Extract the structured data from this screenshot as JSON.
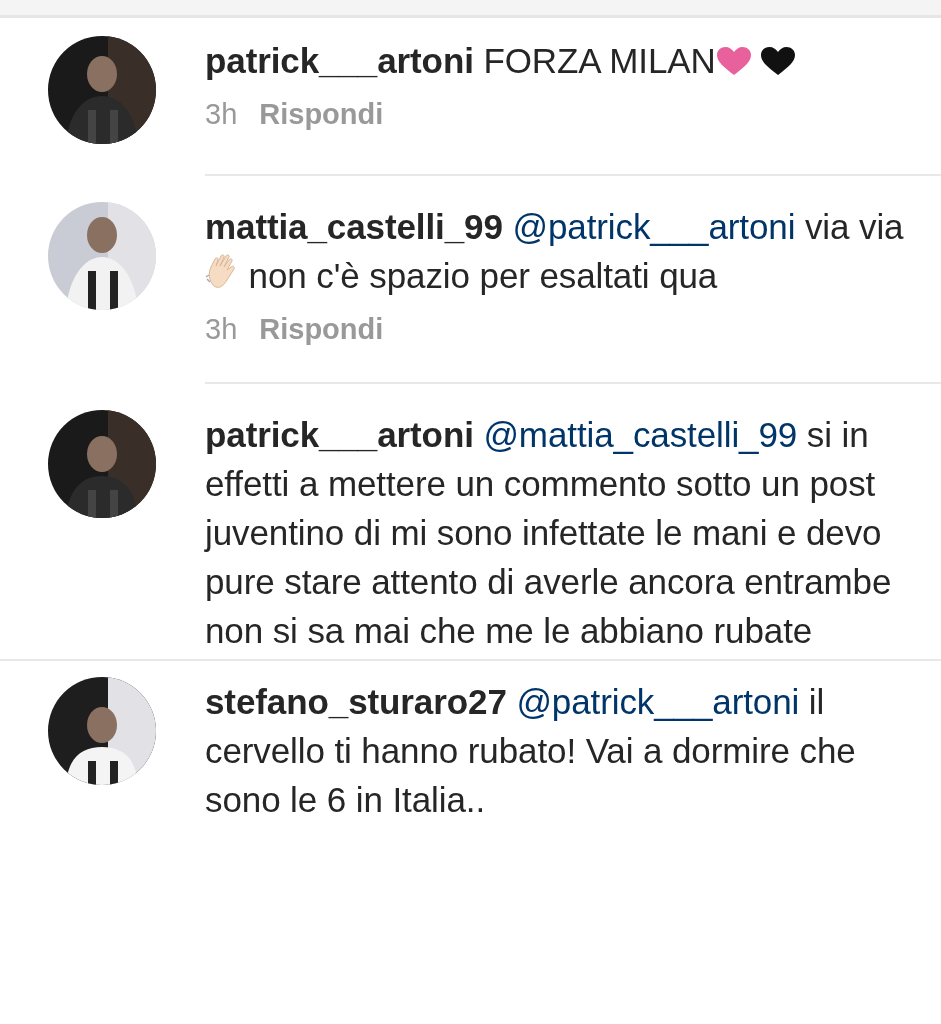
{
  "comments": [
    {
      "username": "patrick___artoni",
      "parts": [
        {
          "kind": "text",
          "text": "FORZA MILAN"
        },
        {
          "kind": "heart",
          "color": "#e8609c"
        },
        {
          "kind": "heart",
          "color": "#111111"
        }
      ],
      "time": "3h",
      "reply": "Rispondi",
      "avatar": {
        "kind": "picture"
      }
    },
    {
      "username": "mattia_castelli_99",
      "parts": [
        {
          "kind": "mention",
          "text": "@patrick___artoni"
        },
        {
          "kind": "text",
          "text": " via via"
        },
        {
          "kind": "wave"
        },
        {
          "kind": "text",
          "text": " non c'è spazio per esaltati qua"
        }
      ],
      "time": "3h",
      "reply": "Rispondi",
      "avatar": {
        "kind": "picture"
      }
    },
    {
      "username": "patrick___artoni",
      "parts": [
        {
          "kind": "mention",
          "text": "@mattia_castelli_99"
        },
        {
          "kind": "text",
          "text": " si in effetti a mettere un commento sotto un post juventino di mi sono infettate le mani e devo pure stare attento di averle ancora entrambe non si sa mai che me le abbiano rubate"
        }
      ],
      "avatar": {
        "kind": "picture"
      }
    },
    {
      "username": "stefano_sturaro27",
      "parts": [
        {
          "kind": "mention",
          "text": "@patrick___artoni"
        },
        {
          "kind": "text",
          "text": " il cervello ti hanno rubato! Vai a dormire che sono le 6 in Italia.."
        }
      ],
      "avatar": {
        "kind": "picture"
      }
    }
  ]
}
